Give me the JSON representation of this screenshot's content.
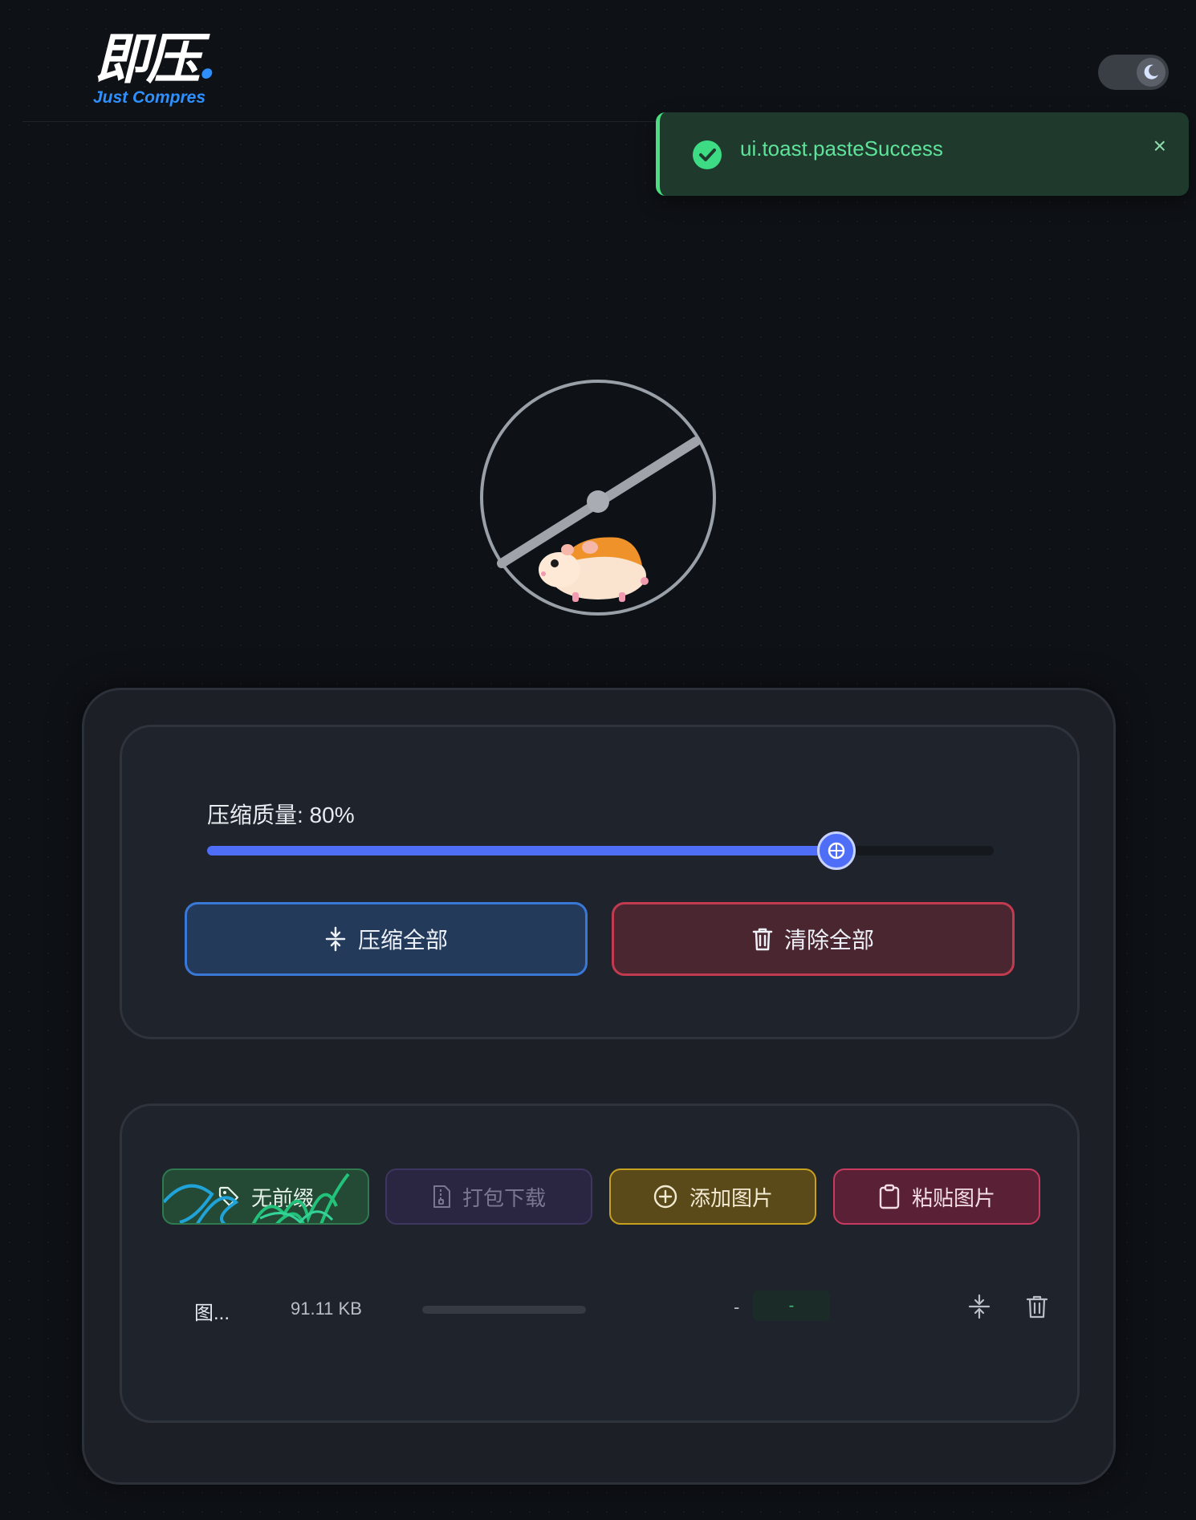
{
  "header": {
    "logo_text": "即压",
    "logo_subtitle": "Just Compres",
    "theme_toggle_icon": "moon-icon"
  },
  "toast": {
    "message": "ui.toast.pasteSuccess",
    "close_label": "×",
    "icon": "check-circle-icon",
    "accent": "#4ade80"
  },
  "settings": {
    "quality_label": "压缩质量: 80%",
    "quality_value": 80,
    "compress_all_label": "压缩全部",
    "clear_all_label": "清除全部"
  },
  "actions": {
    "prefix_label": "无前缀",
    "zip_label": "打包下载",
    "add_label": "添加图片",
    "paste_label": "粘贴图片"
  },
  "files": [
    {
      "name": "图...",
      "size": "91.11 KB",
      "compressed_size": "-",
      "saving": "-",
      "progress": 0
    }
  ],
  "colors": {
    "primary": "#4f6ef7",
    "danger": "#c23a4f",
    "success": "#4ade80",
    "warning": "#c8a020",
    "pink": "#c83a60"
  }
}
